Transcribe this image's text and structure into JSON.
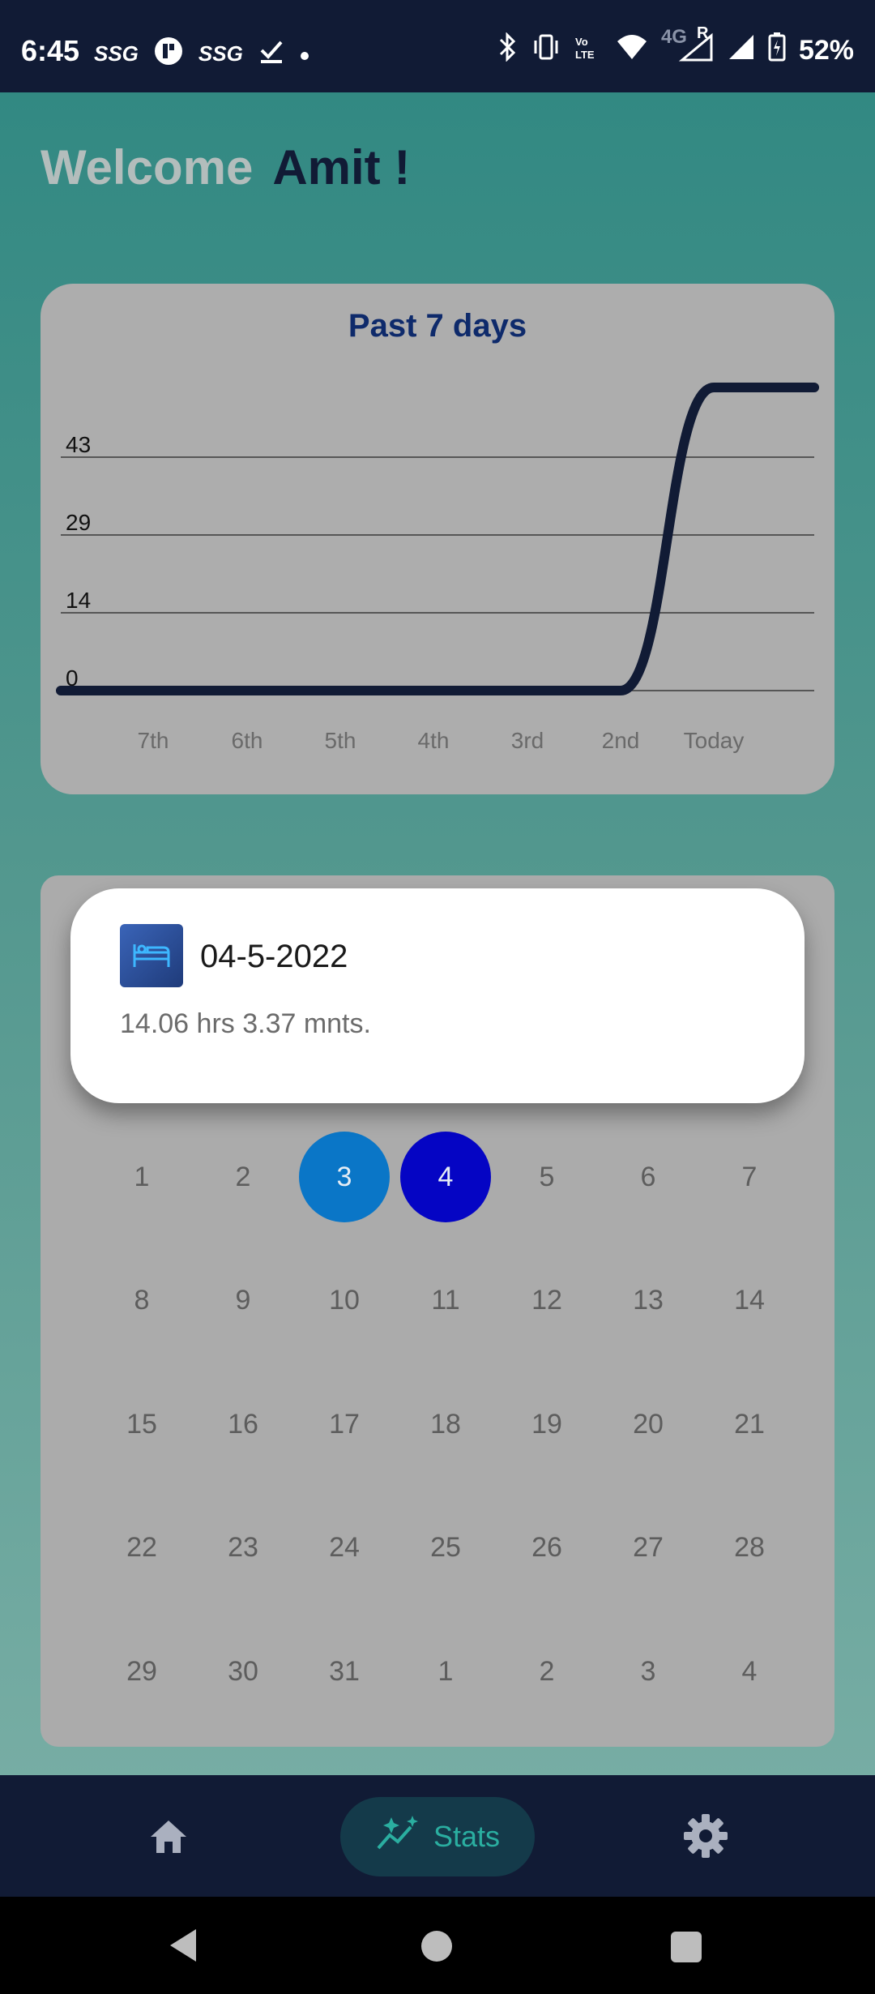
{
  "status_bar": {
    "time": "6:45",
    "left_icons": [
      "SSG",
      "SSG"
    ],
    "battery": "52%",
    "network": "4G",
    "roaming": "R"
  },
  "welcome": {
    "greeting": "Welcome",
    "name": "Amit !"
  },
  "chart_card": {
    "chart_data": {
      "type": "line",
      "title": "Past 7 days",
      "xlabel": "",
      "ylabel": "",
      "categories": [
        "7th",
        "6th",
        "5th",
        "4th",
        "3rd",
        "2nd",
        "Today"
      ],
      "y_ticks": [
        "0",
        "14",
        "29",
        "43"
      ],
      "ylim": [
        0,
        58
      ],
      "series": [
        {
          "values": [
            0,
            0,
            0,
            0,
            0,
            0,
            58
          ]
        }
      ],
      "grid": true,
      "line_color": "#111b35"
    }
  },
  "calendar": {
    "days": [
      "1",
      "2",
      "3",
      "4",
      "5",
      "6",
      "7",
      "8",
      "9",
      "10",
      "11",
      "12",
      "13",
      "14",
      "15",
      "16",
      "17",
      "18",
      "19",
      "20",
      "21",
      "22",
      "23",
      "24",
      "25",
      "26",
      "27",
      "28",
      "29",
      "30",
      "31",
      "1",
      "2",
      "3",
      "4"
    ],
    "selected_prev_index": 2,
    "selected_index": 3
  },
  "popup": {
    "icon": "bed-icon",
    "date": "04-5-2022",
    "duration": "14.06 hrs 3.37 mnts."
  },
  "bottom_nav": {
    "home_icon": "home-icon",
    "stats_label": "Stats",
    "stats_icon": "sparkle-chart-icon",
    "settings_icon": "gear-icon"
  },
  "colors": {
    "accent": "#0505c4",
    "secondary": "#0a76c7",
    "nav_bg": "#111b35",
    "stats_text": "#2aaea0"
  }
}
